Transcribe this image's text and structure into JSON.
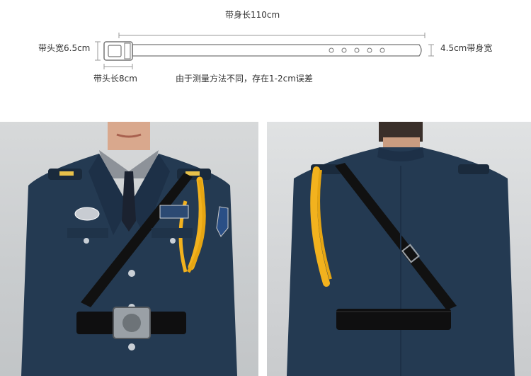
{
  "belt_spec": {
    "total_length": "带身长110cm",
    "buckle_width": "带头宽6.5cm",
    "body_width": "4.5cm带身宽",
    "buckle_length": "带头长8cm",
    "tolerance_note": "由于测量方法不同，存在1-2cm误差"
  },
  "photos": {
    "front": {
      "badge_text": "中国保安"
    },
    "back": {}
  },
  "colors": {
    "uniform": "#243a52",
    "belt": "#111111",
    "aiguillette": "#f2b21e",
    "background": "#ffffff"
  }
}
